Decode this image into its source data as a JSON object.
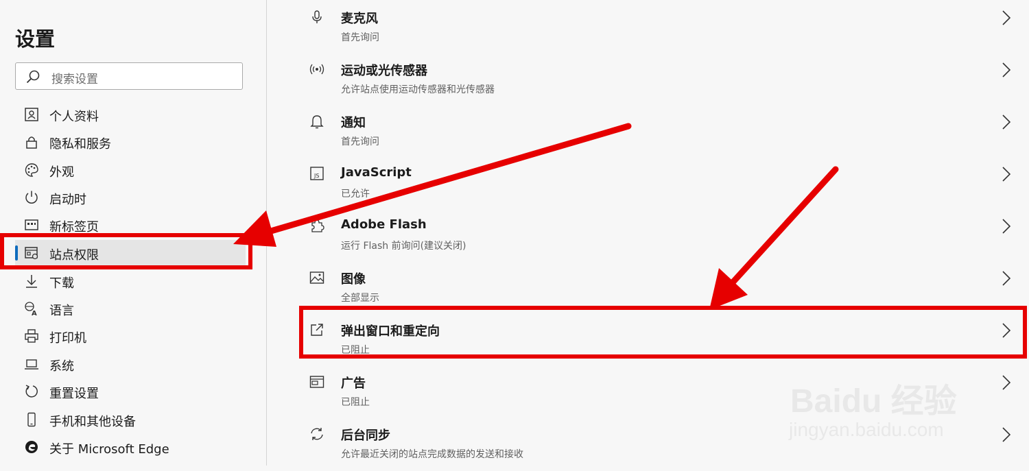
{
  "sidebar": {
    "title": "设置",
    "search_placeholder": "搜索设置",
    "items": [
      {
        "label": "个人资料",
        "icon": "profile-icon"
      },
      {
        "label": "隐私和服务",
        "icon": "lock-icon"
      },
      {
        "label": "外观",
        "icon": "palette-icon"
      },
      {
        "label": "启动时",
        "icon": "power-icon"
      },
      {
        "label": "新标签页",
        "icon": "new-tab-icon"
      },
      {
        "label": "站点权限",
        "icon": "site-permissions-icon",
        "active": true
      },
      {
        "label": "下载",
        "icon": "download-icon"
      },
      {
        "label": "语言",
        "icon": "language-icon"
      },
      {
        "label": "打印机",
        "icon": "printer-icon"
      },
      {
        "label": "系统",
        "icon": "laptop-icon"
      },
      {
        "label": "重置设置",
        "icon": "reset-icon"
      },
      {
        "label": "手机和其他设备",
        "icon": "phone-icon"
      },
      {
        "label": "关于 Microsoft Edge",
        "icon": "edge-logo-icon"
      }
    ]
  },
  "permissions": [
    {
      "title": "麦克风",
      "subtitle": "首先询问",
      "icon": "microphone-icon"
    },
    {
      "title": "运动或光传感器",
      "subtitle": "允许站点使用运动传感器和光传感器",
      "icon": "sensor-icon"
    },
    {
      "title": "通知",
      "subtitle": "首先询问",
      "icon": "bell-icon"
    },
    {
      "title": "JavaScript",
      "subtitle": "已允许",
      "icon": "javascript-icon"
    },
    {
      "title": "Adobe Flash",
      "subtitle": "运行 Flash 前询问(建议关闭)",
      "icon": "puzzle-icon"
    },
    {
      "title": "图像",
      "subtitle": "全部显示",
      "icon": "image-icon"
    },
    {
      "title": "弹出窗口和重定向",
      "subtitle": "已阻止",
      "icon": "popup-icon"
    },
    {
      "title": "广告",
      "subtitle": "已阻止",
      "icon": "ads-icon"
    },
    {
      "title": "后台同步",
      "subtitle": "允许最近关闭的站点完成数据的发送和接收",
      "icon": "sync-icon"
    }
  ],
  "watermark": {
    "brand": "Baidu 经验",
    "url": "jingyan.baidu.com"
  },
  "colors": {
    "accent": "#0f6cbd",
    "annotation": "#e60000",
    "background": "#f7f7f7"
  }
}
